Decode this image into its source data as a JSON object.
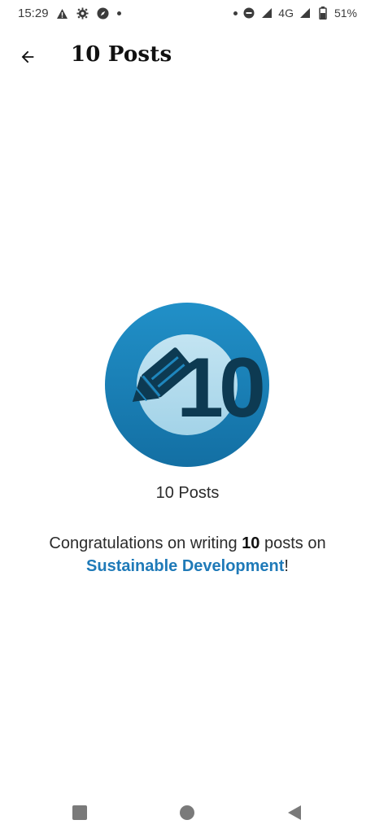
{
  "status_bar": {
    "time": "15:29",
    "network": "4G",
    "battery": "51%",
    "left_icons": [
      "warning-icon",
      "gear-icon",
      "compass-icon",
      "dot-icon"
    ],
    "right_icons": [
      "dot-icon",
      "do-not-disturb-icon",
      "signal-icon",
      "signal-icon",
      "battery-icon"
    ]
  },
  "app_bar": {
    "back_icon": "arrow-left-icon",
    "title": "10 Posts"
  },
  "badge": {
    "number": "10",
    "icon": "pencil-icon",
    "outer_color": "#1e86bd",
    "inner_color": "#a9d8ec",
    "glyph_color": "#0d3a52",
    "caption": "10 Posts"
  },
  "message": {
    "prefix": "Congratulations on writing ",
    "count": "10",
    "middle": " posts on ",
    "site": "Sustainable Development",
    "suffix": "!",
    "link_color": "#1f7ab8"
  },
  "nav_bar": {
    "icons": [
      "recents-square-icon",
      "home-circle-icon",
      "back-triangle-icon"
    ]
  }
}
